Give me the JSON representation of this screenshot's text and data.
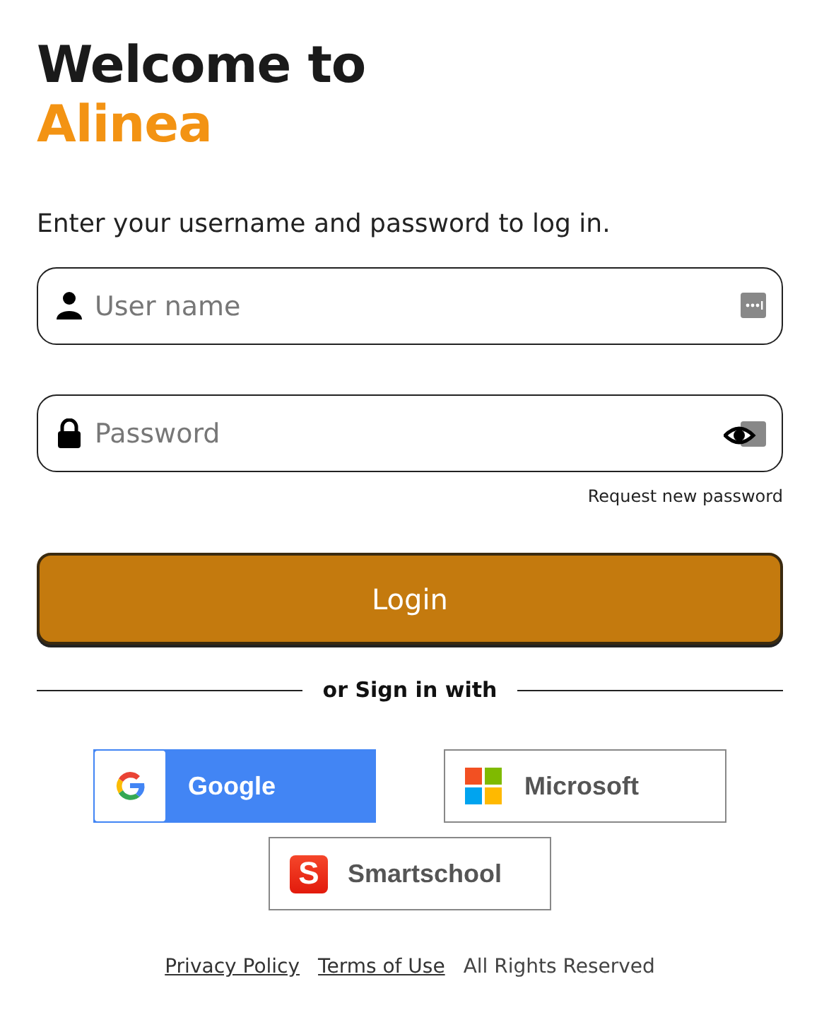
{
  "title": {
    "line1": "Welcome to",
    "line2": "Alinea"
  },
  "instruction": "Enter your username and password to log in.",
  "fields": [
    {
      "kind": "user",
      "placeholder": "User name"
    },
    {
      "kind": "password",
      "placeholder": "Password"
    }
  ],
  "request_password": "Request new password",
  "login_button": "Login",
  "divider": "or Sign in with",
  "providers": [
    {
      "kind": "google",
      "label": "Google"
    },
    {
      "kind": "microsoft",
      "label": "Microsoft"
    },
    {
      "kind": "smartschool",
      "label": "Smartschool",
      "logo_letter": "S"
    }
  ],
  "footer": {
    "links": [
      "Privacy Policy",
      "Terms of Use"
    ],
    "text": "All Rights Reserved"
  }
}
